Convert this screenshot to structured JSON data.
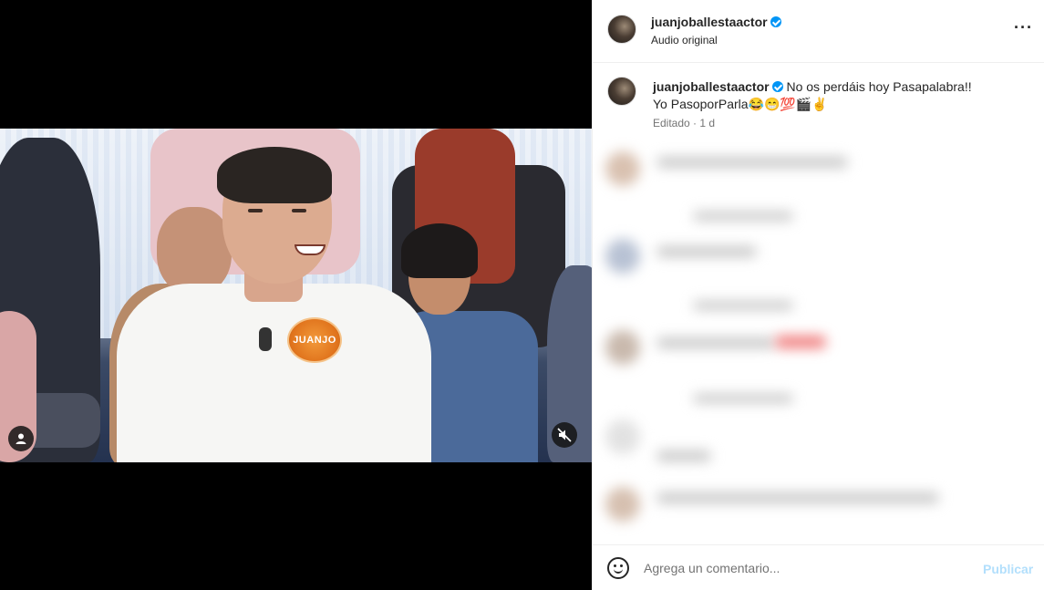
{
  "post": {
    "username": "juanjoballestaactor",
    "audio": "Audio original",
    "more_icon": "more-horizontal-icon"
  },
  "video": {
    "badge_text": "JUANJO",
    "mute_icon": "speaker-muted-icon",
    "tag_icon": "person-tag-icon"
  },
  "caption": {
    "username": "juanjoballestaactor",
    "line1": "No os perdáis hoy Pasapalabra!!",
    "line2": "Yo PasoporParla😂😁💯🎬✌️",
    "meta": "Editado · 1 d"
  },
  "comment_box": {
    "placeholder": "Agrega un comentario...",
    "publish_label": "Publicar",
    "emoji_icon": "emoji-smile-icon"
  },
  "colors": {
    "verified": "#0095f6",
    "publish_disabled": "#b2dffc"
  }
}
